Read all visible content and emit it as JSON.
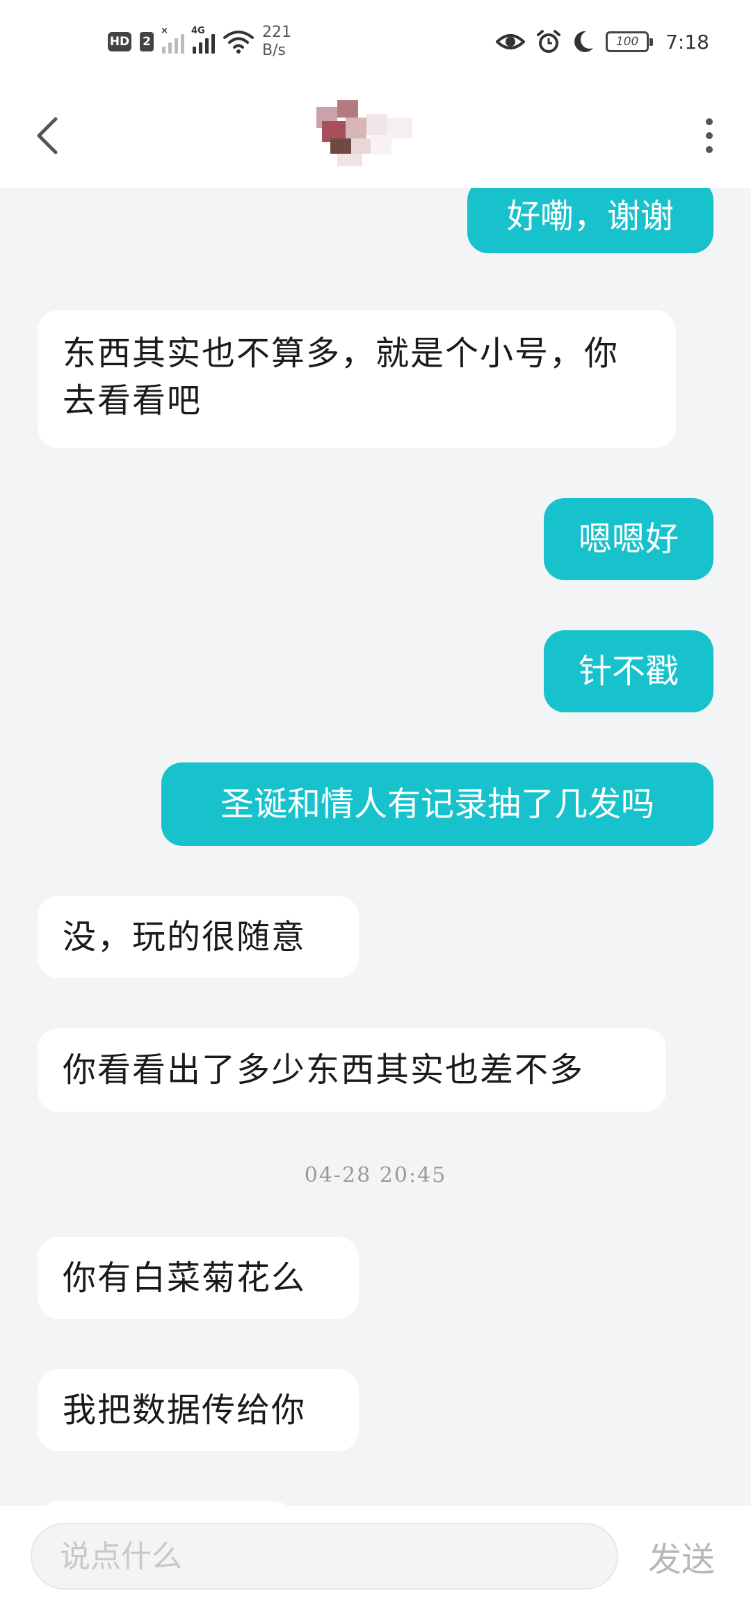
{
  "status_bar": {
    "hd_label": "HD",
    "sim_number": "2",
    "network_type": "4G",
    "net_speed_value": "221",
    "net_speed_unit": "B/s",
    "battery_level": "100",
    "time": "7:18"
  },
  "header": {
    "contact_name": "",
    "icons": [
      "back-arrow-icon",
      "avatar",
      "more-vertical-icon"
    ]
  },
  "messages": [
    {
      "direction": "out",
      "text": "好嘞，谢谢"
    },
    {
      "direction": "in",
      "text": "东西其实也不算多，就是个小号，你去看看吧"
    },
    {
      "direction": "out",
      "text": "嗯嗯好"
    },
    {
      "direction": "out",
      "text": "针不戳"
    },
    {
      "direction": "out",
      "text": "圣诞和情人有记录抽了几发吗"
    },
    {
      "direction": "in",
      "text": "没，玩的很随意"
    },
    {
      "direction": "in",
      "text": "你看看出了多少东西其实也差不多"
    },
    {
      "direction": "timestamp",
      "text": "04-28 20:45"
    },
    {
      "direction": "in",
      "text": "你有白菜菊花么"
    },
    {
      "direction": "in",
      "text": "我把数据传给你"
    }
  ],
  "input_bar": {
    "placeholder": "说点什么",
    "value": "",
    "send_label": "发送"
  },
  "colors": {
    "accent": "#18c2cc",
    "chat_background": "#f3f4f6",
    "incoming_bubble": "#ffffff"
  }
}
